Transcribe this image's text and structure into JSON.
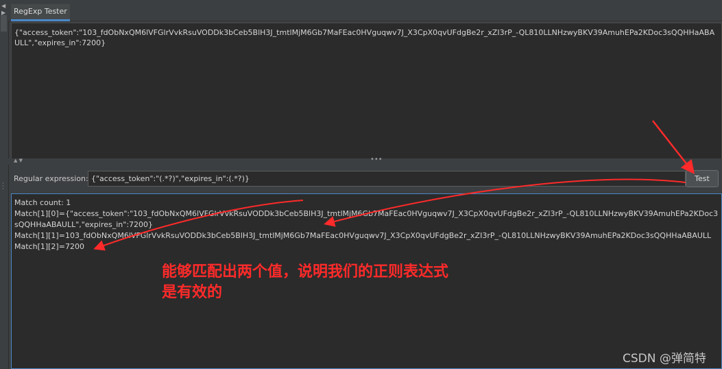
{
  "tab": {
    "label": "RegExp Tester"
  },
  "input": {
    "text": "{\"access_token\":\"103_fdObNxQM6lVFGlrVvkRsuVODDk3bCeb5BlH3J_tmtlMjM6Gb7MaFEac0HVguqwv7J_X3CpX0qvUFdgBe2r_xZI3rP_-QL810LLNHzwyBKV39AmuhEPa2KDoc3sQQHHaABAULL\",\"expires_in\":7200}"
  },
  "regex": {
    "label": "Regular expression:",
    "value": "{\"access_token\":\"(.*?)\",\"expires_in\":(.*?)}",
    "test_button": "Test"
  },
  "results": {
    "lines": [
      "Match count: 1",
      "Match[1][0]={\"access_token\":\"103_fdObNxQM6lVFGlrVvkRsuVODDk3bCeb5BlH3J_tmtlMjM6Gb7MaFEac0HVguqwv7J_X3CpX0qvUFdgBe2r_xZI3rP_-QL810LLNHzwyBKV39AmuhEPa2KDoc3sQQHHaABAULL\",\"expires_in\":7200}",
      "Match[1][1]=103_fdObNxQM6lVFGlrVvkRsuVODDk3bCeb5BlH3J_tmtlMjM6Gb7MaFEac0HVguqwv7J_X3CpX0qvUFdgBe2r_xZI3rP_-QL810LLNHzwyBKV39AmuhEPa2KDoc3sQQHHaABAULL",
      "Match[1][2]=7200"
    ]
  },
  "annotation": {
    "line1": "能够匹配出两个值，说明我们的正则表达式",
    "line2": "是有效的",
    "color": "#ff2a2a"
  },
  "watermark": "CSDN @弹简特",
  "colors": {
    "accent": "#4a88c7",
    "editor_bg": "#2b2b2b",
    "panel_bg": "#3c3f41"
  }
}
